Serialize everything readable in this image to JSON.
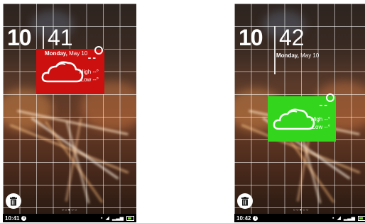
{
  "screens": [
    {
      "clock_hour": "10",
      "clock_minute": "41",
      "date_day": "Monday,",
      "date_rest": "May 10",
      "widget": {
        "color": "#cc1010",
        "temp": "--",
        "high": "High --°",
        "low": "Low --°",
        "icon": "cloud-icon"
      },
      "page_dots": "○○●○○",
      "status_time": "10:41"
    },
    {
      "clock_hour": "10",
      "clock_minute": "42",
      "date_day": "Monday,",
      "date_rest": "May 10",
      "widget": {
        "color": "#33d61c",
        "temp": "--",
        "high": "High --°",
        "low": "Low --°",
        "icon": "cloud-icon"
      },
      "page_dots": "○○●○○",
      "status_time": "10:42"
    }
  ]
}
